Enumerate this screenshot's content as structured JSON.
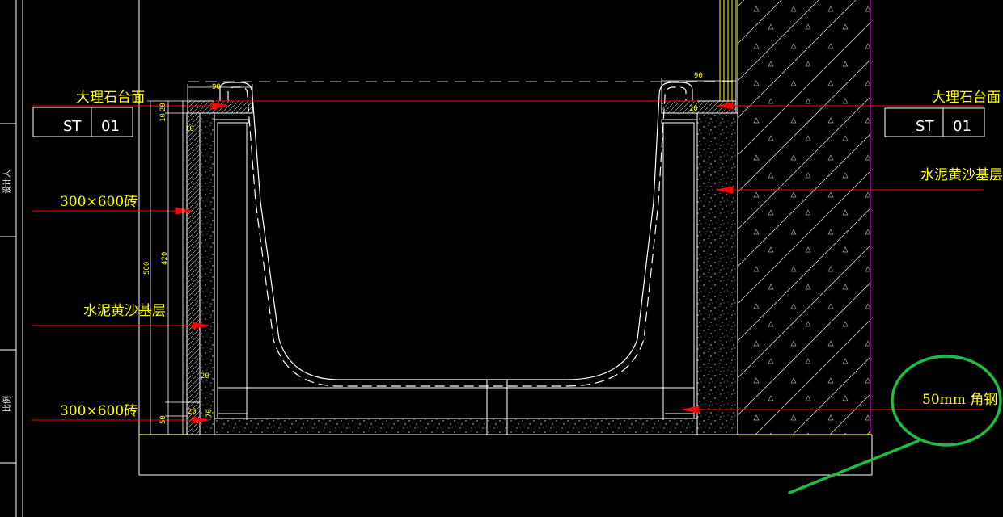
{
  "labels": {
    "marble_top_left": "大理石台面",
    "marble_top_right": "大理石台面",
    "tile_upper": "300×600砖",
    "cement_base_left": "水泥黄沙基层",
    "tile_lower": "300×600砖",
    "cement_base_right": "水泥黄沙基层",
    "angle_steel": "50mm 角钢"
  },
  "tags": {
    "left": {
      "code": "ST",
      "num": "01"
    },
    "right": {
      "code": "ST",
      "num": "01"
    }
  },
  "dims": {
    "top_left_width": "90",
    "top_right_width": "90",
    "slab_10": "10",
    "slab_20": "20",
    "edge_10": "10",
    "overall_height": "500",
    "tile_height": "420",
    "bottom_20_a": "20",
    "bottom_20_b": "20",
    "bottom_70": "70",
    "bottom_50": "50",
    "right_20": "20"
  },
  "side_panel": {
    "text_upper": "设计人",
    "text_lower": "比例"
  },
  "colors": {
    "background": "#000000",
    "leader_red": "#ff0000",
    "text_yellow": "#ffff00",
    "outline_white": "#ffffff",
    "wall_purple": "#b000b0",
    "highlight_green": "#22bb44"
  }
}
